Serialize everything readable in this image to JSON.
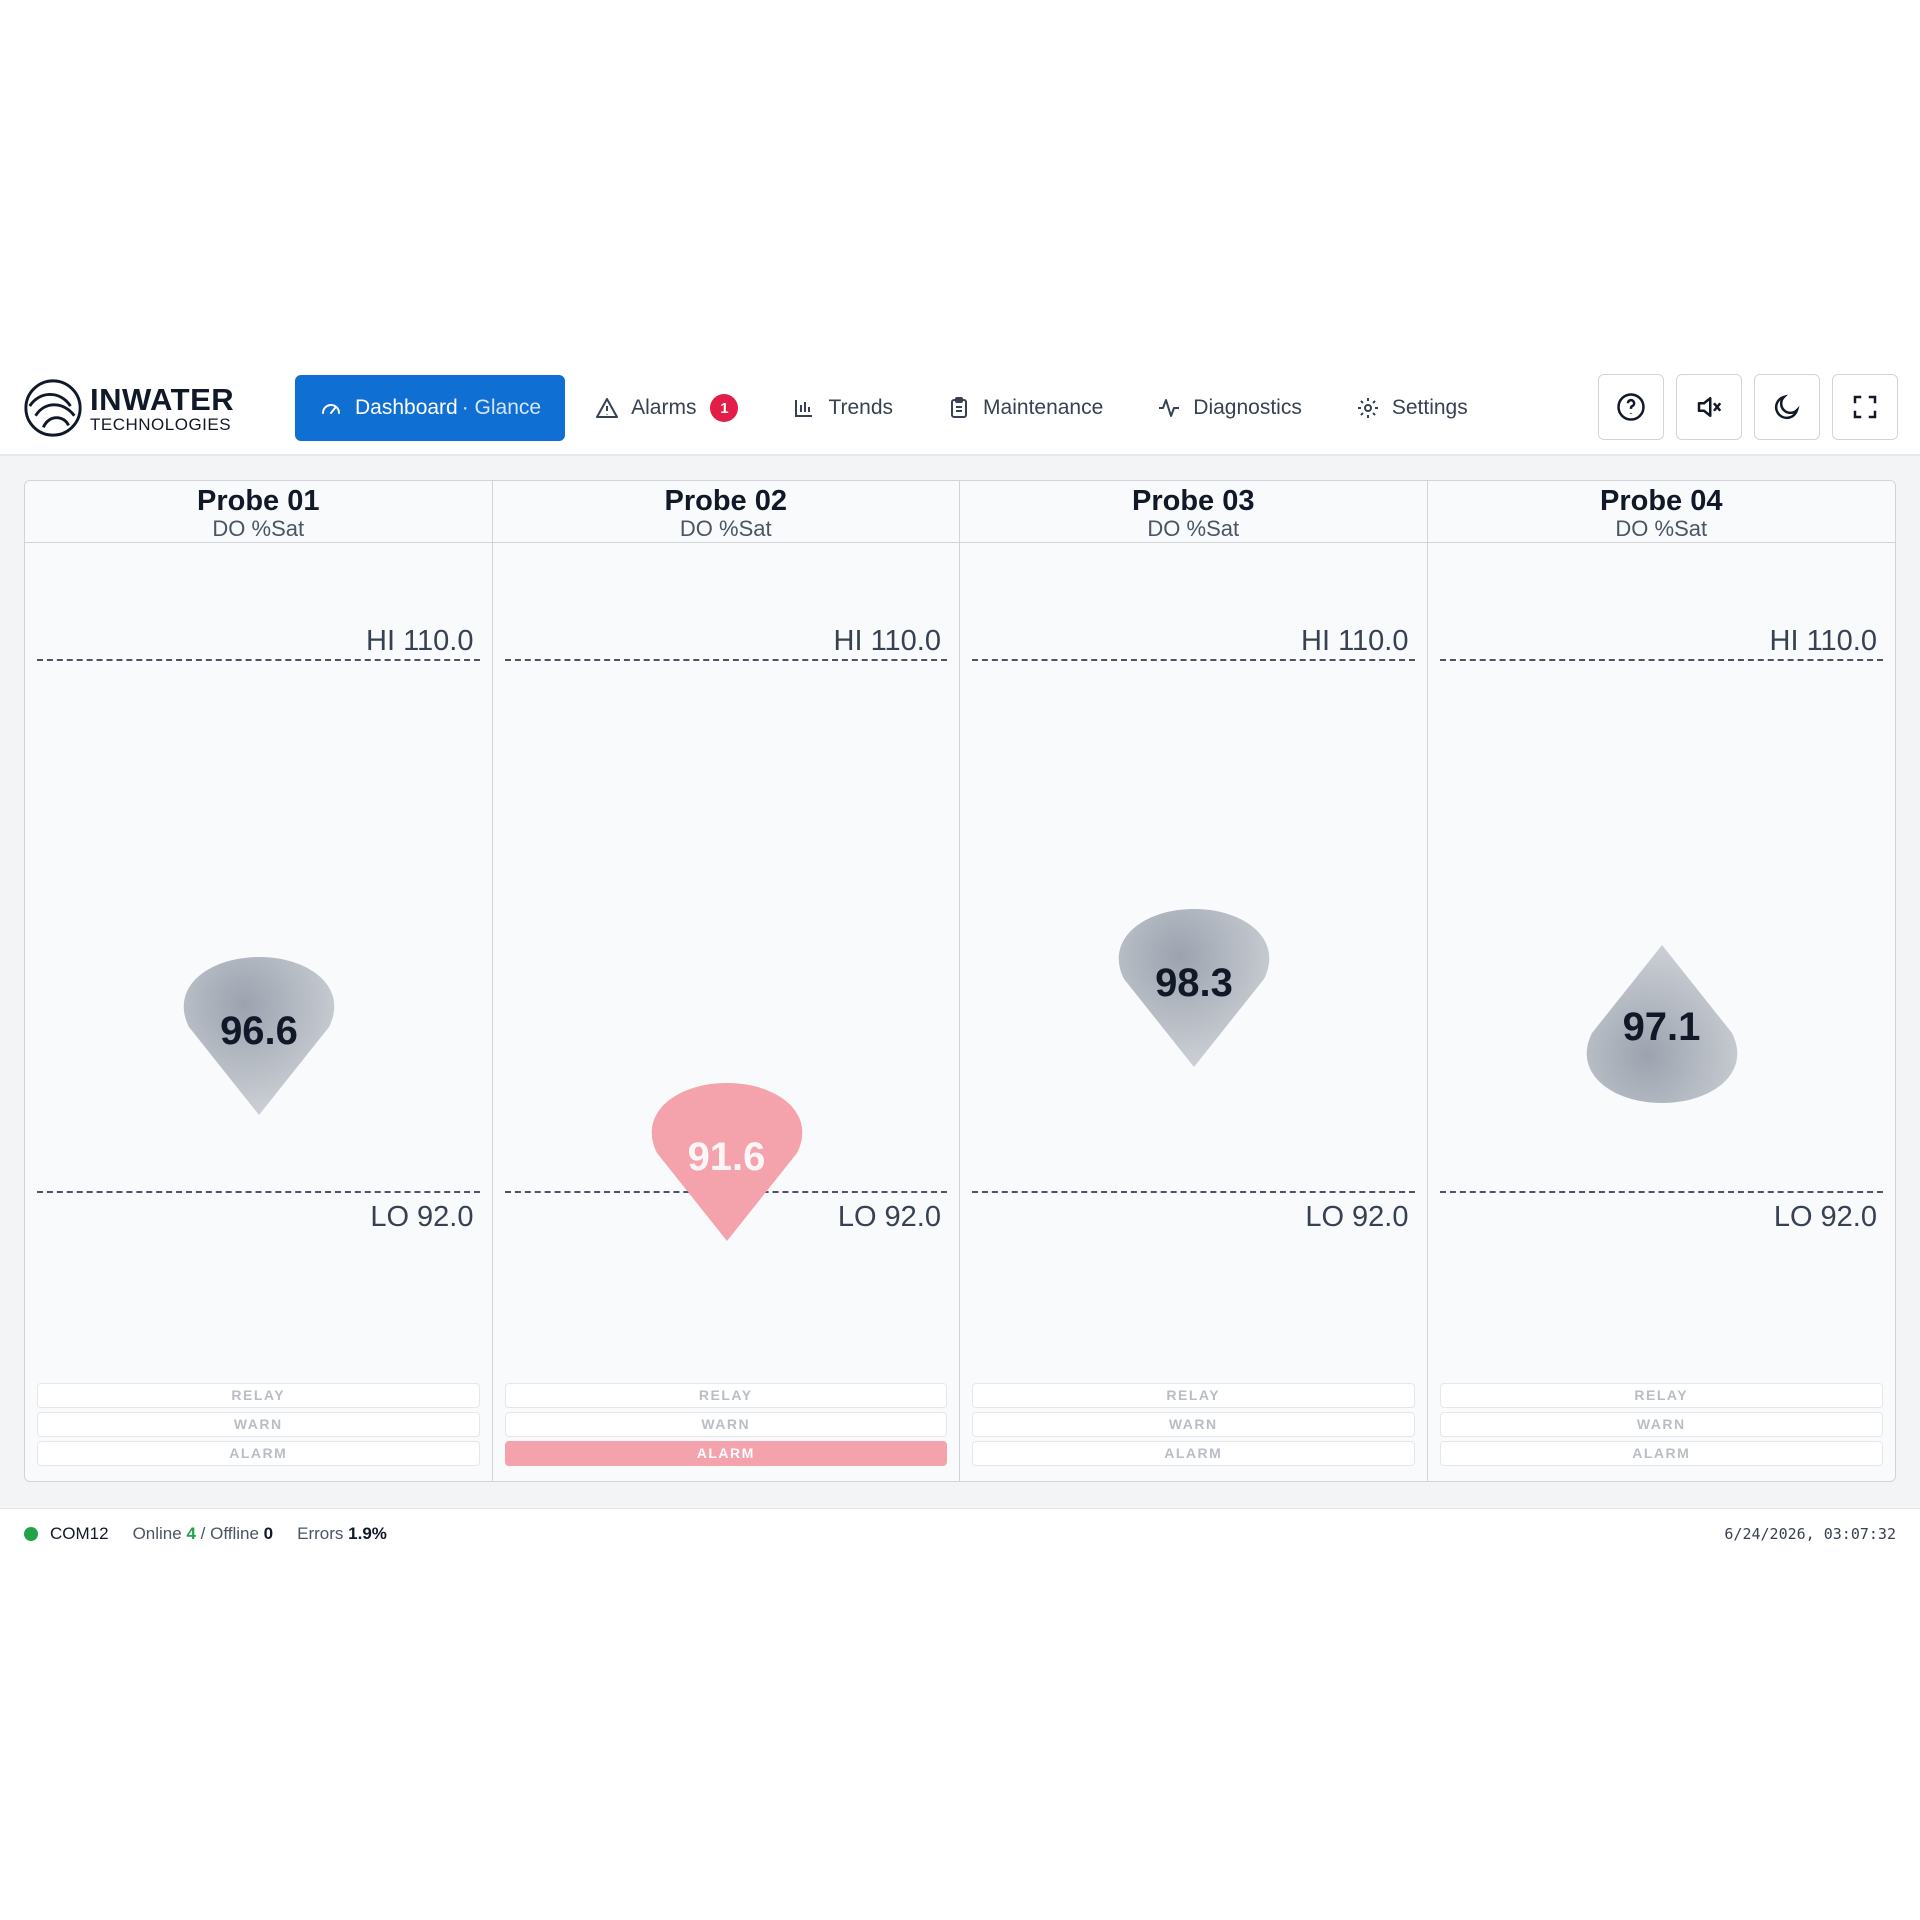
{
  "brand": {
    "name_line1": "INWATER",
    "name_line2": "TECHNOLOGIES"
  },
  "nav": {
    "dashboard_label": "Dashboard",
    "dashboard_sub": "· Glance",
    "alarms_label": "Alarms",
    "alarms_count": "1",
    "trends_label": "Trends",
    "maintenance_label": "Maintenance",
    "diagnostics_label": "Diagnostics",
    "settings_label": "Settings"
  },
  "tools": [
    "help-icon",
    "mute-icon",
    "dark-mode-icon",
    "fullscreen-icon"
  ],
  "probes": [
    {
      "title": "Probe 01",
      "unit": "DO %Sat",
      "value": "96.6",
      "hi_label": "HI 110.0",
      "lo_label": "LO 92.0",
      "state": "normal",
      "relay": "RELAY",
      "warn": "WARN",
      "alarm": "ALARM"
    },
    {
      "title": "Probe 02",
      "unit": "DO %Sat",
      "value": "91.6",
      "hi_label": "HI 110.0",
      "lo_label": "LO 92.0",
      "state": "alarm",
      "relay": "RELAY",
      "warn": "WARN",
      "alarm": "ALARM"
    },
    {
      "title": "Probe 03",
      "unit": "DO %Sat",
      "value": "98.3",
      "hi_label": "HI 110.0",
      "lo_label": "LO 92.0",
      "state": "normal",
      "relay": "RELAY",
      "warn": "WARN",
      "alarm": "ALARM"
    },
    {
      "title": "Probe 04",
      "unit": "DO %Sat",
      "value": "97.1",
      "hi_label": "HI 110.0",
      "lo_label": "LO 92.0",
      "state": "normal",
      "relay": "RELAY",
      "warn": "WARN",
      "alarm": "ALARM"
    }
  ],
  "footer": {
    "port": "COM12",
    "online_label": "Online",
    "online_count": "4",
    "offline_label": "/ Offline",
    "offline_count": "0",
    "errors_label": "Errors",
    "errors_value": "1.9%",
    "timestamp": "6/24/2026, 03:07:32"
  },
  "colors": {
    "accent": "#0f6fd3",
    "alarm": "#f4a3ad",
    "badge": "#e11d48",
    "online": "#22a34a"
  }
}
